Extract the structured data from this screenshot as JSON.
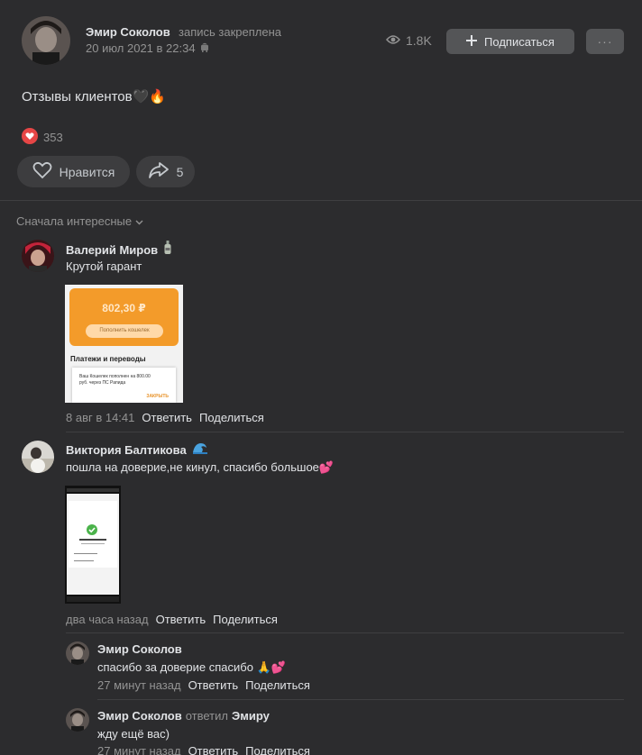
{
  "header": {
    "author": "Эмир Соколов",
    "pinned": "запись закреплена",
    "date": "20 июл 2021 в 22:34",
    "views": "1.8K",
    "subscribe": "Подписаться",
    "more": "···"
  },
  "post": {
    "text": "Отзывы клиентов🖤🔥",
    "reactions_count": "353",
    "like_label": "Нравится",
    "share_count": "5"
  },
  "sort_label": "Сначала интересные",
  "comments": [
    {
      "name": "Валерий Миров",
      "text": "Крутой гарант",
      "attachment": {
        "balance": "802,30 ₽",
        "topup": "Пополнить кошелек",
        "section": "Платежи и переводы",
        "notice": "Ваш Кошелек пополнен на 800.00 руб. через ПС Рапида",
        "close": "ЗАКРЫТЬ"
      },
      "time": "8 авг в 14:41",
      "reply": "Ответить",
      "share": "Поделиться"
    },
    {
      "name": "Виктория Балтикова",
      "text": "пошла на доверие,не кинул, спасибо большое💕",
      "time": "два часа назад",
      "reply": "Ответить",
      "share": "Поделиться"
    }
  ],
  "replies": [
    {
      "name": "Эмир Соколов",
      "text": "спасибо за доверие спасибо 🙏💕",
      "time": "27 минут назад",
      "reply": "Ответить",
      "share": "Поделиться"
    },
    {
      "name": "Эмир Соколов",
      "replied": "ответил",
      "to": "Эмиру",
      "text": "жду ещё вас)",
      "time": "27 минут назад",
      "reply": "Ответить",
      "share": "Поделиться"
    }
  ]
}
